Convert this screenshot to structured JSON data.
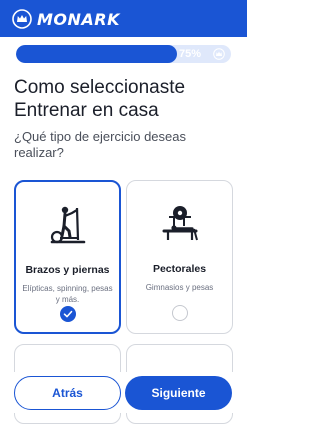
{
  "brand": {
    "name": "MONARK",
    "icon": "crown-icon"
  },
  "progress": {
    "percent": 75,
    "label": "75%",
    "icon": "crown-icon"
  },
  "question": {
    "title": "Como seleccionaste Entrenar en casa",
    "subtitle": "¿Qué tipo de ejercicio deseas realizar?"
  },
  "options": [
    {
      "title": "Brazos y piernas",
      "desc": "Elípticas, spinning, pesas y más.",
      "selected": true,
      "icon": "elliptical-trainer-icon"
    },
    {
      "title": "Pectorales",
      "desc": "Gimnasios y pesas",
      "selected": false,
      "icon": "bench-press-icon"
    }
  ],
  "buttons": {
    "back": "Atrás",
    "next": "Siguiente"
  },
  "colors": {
    "primary": "#1a55d4",
    "progress_track": "#dfe8fb"
  }
}
